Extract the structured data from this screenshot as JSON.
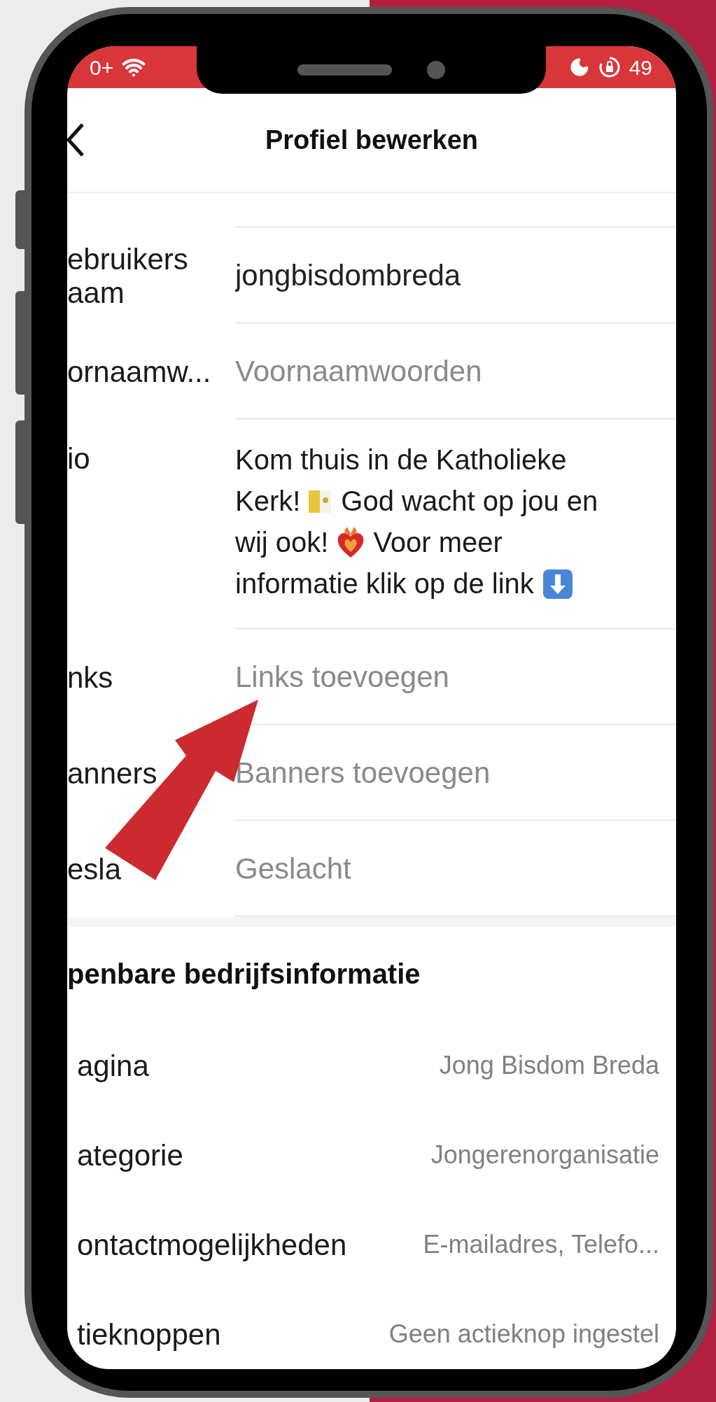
{
  "status_bar": {
    "left_text": "0+",
    "right_text": "49"
  },
  "header": {
    "title": "Profiel bewerken"
  },
  "profile_fields": [
    {
      "kind": "text",
      "label": "ebruikers aam",
      "value": "jongbisdombreda"
    },
    {
      "kind": "text",
      "label": "ornaamw...",
      "placeholder": "Voornaamwoorden"
    },
    {
      "kind": "bio",
      "label": "io",
      "value_lines": [
        [
          {
            "kind": "text",
            "text": "Kom thuis in de Katholieke"
          }
        ],
        [
          {
            "kind": "text",
            "text": "Kerk!"
          },
          {
            "kind": "icon"
          },
          {
            "kind": "text",
            "text": "God wacht op jou en"
          }
        ],
        [
          {
            "kind": "text",
            "text": "wij ook!"
          },
          {
            "kind": "icon"
          },
          {
            "kind": "text",
            "text": "Voor meer"
          }
        ],
        [
          {
            "kind": "text",
            "text": "informatie klik op de link"
          },
          {
            "kind": "icon"
          }
        ]
      ]
    },
    {
      "kind": "text",
      "label": "nks",
      "placeholder": "Links toevoegen"
    },
    {
      "kind": "text",
      "label": "anners",
      "placeholder": "Banners toevoegen"
    },
    {
      "kind": "text",
      "label": "esla",
      "placeholder": "Geslacht"
    }
  ],
  "business_section": {
    "title": "penbare bedrijfsinformatie",
    "rows": [
      {
        "label": "agina",
        "value": "Jong Bisdom Breda"
      },
      {
        "label": "ategorie",
        "value": "Jongerenorganisatie"
      },
      {
        "label": "ontactmogelijkheden",
        "value": "E-mailadres, Telefo..."
      },
      {
        "label": "tieknoppen",
        "value": "Geen actieknop ingestel"
      }
    ]
  }
}
